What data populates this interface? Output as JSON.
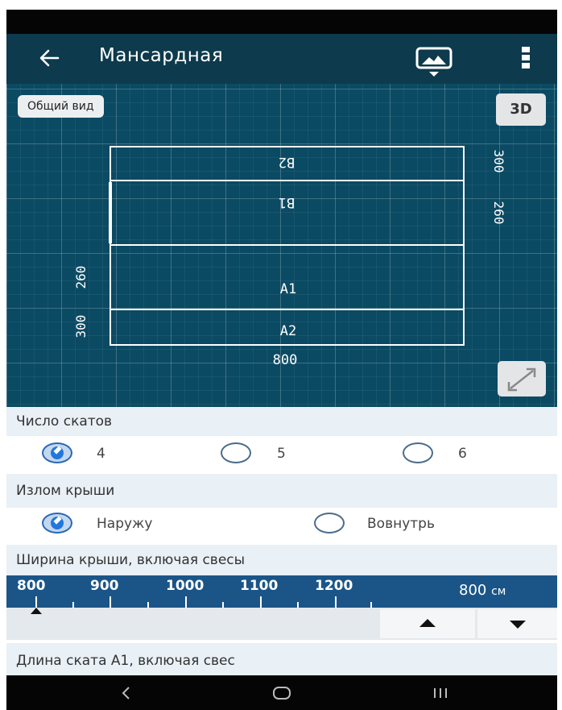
{
  "app_bar": {
    "title": "Мансардная",
    "back_icon": "arrow-left-icon",
    "image_icon": "landscape-image-dropdown-icon",
    "more_icon": "more-vertical-icon"
  },
  "canvas": {
    "overview_label": "Общий вид",
    "view_3d_label": "3D",
    "expand_icon": "expand-diagonal-icon",
    "slopes": [
      {
        "label": "B2",
        "mirrored": true
      },
      {
        "label": "B1",
        "mirrored": true
      },
      {
        "label": "A1",
        "mirrored": false
      },
      {
        "label": "A2",
        "mirrored": false
      }
    ],
    "dims_right": [
      "300",
      "260"
    ],
    "dims_left": [
      "260",
      "300"
    ],
    "dim_bottom": "800",
    "colors": {
      "background": "#0b4a63",
      "lines": "#ffffff"
    }
  },
  "slopes_count": {
    "label": "Число скатов",
    "options": [
      {
        "label": "4",
        "checked": true
      },
      {
        "label": "5",
        "checked": false
      },
      {
        "label": "6",
        "checked": false
      }
    ]
  },
  "roof_break": {
    "label": "Излом крыши",
    "options": [
      {
        "label": "Наружу",
        "checked": true
      },
      {
        "label": "Вовнутрь",
        "checked": false
      }
    ]
  },
  "roof_width": {
    "label": "Ширина крыши, включая свесы",
    "scale_labels": [
      "800",
      "900",
      "1000",
      "1100",
      "1200"
    ],
    "value": "800",
    "unit": "см",
    "increase_icon": "triangle-up-icon",
    "decrease_icon": "triangle-down-icon"
  },
  "slope_length": {
    "label": "Длина ската A1, включая свес"
  },
  "nav_bar": {
    "back_icon": "chevron-left-icon",
    "home_icon": "home-pill-icon",
    "recents_icon": "recents-bars-icon"
  }
}
